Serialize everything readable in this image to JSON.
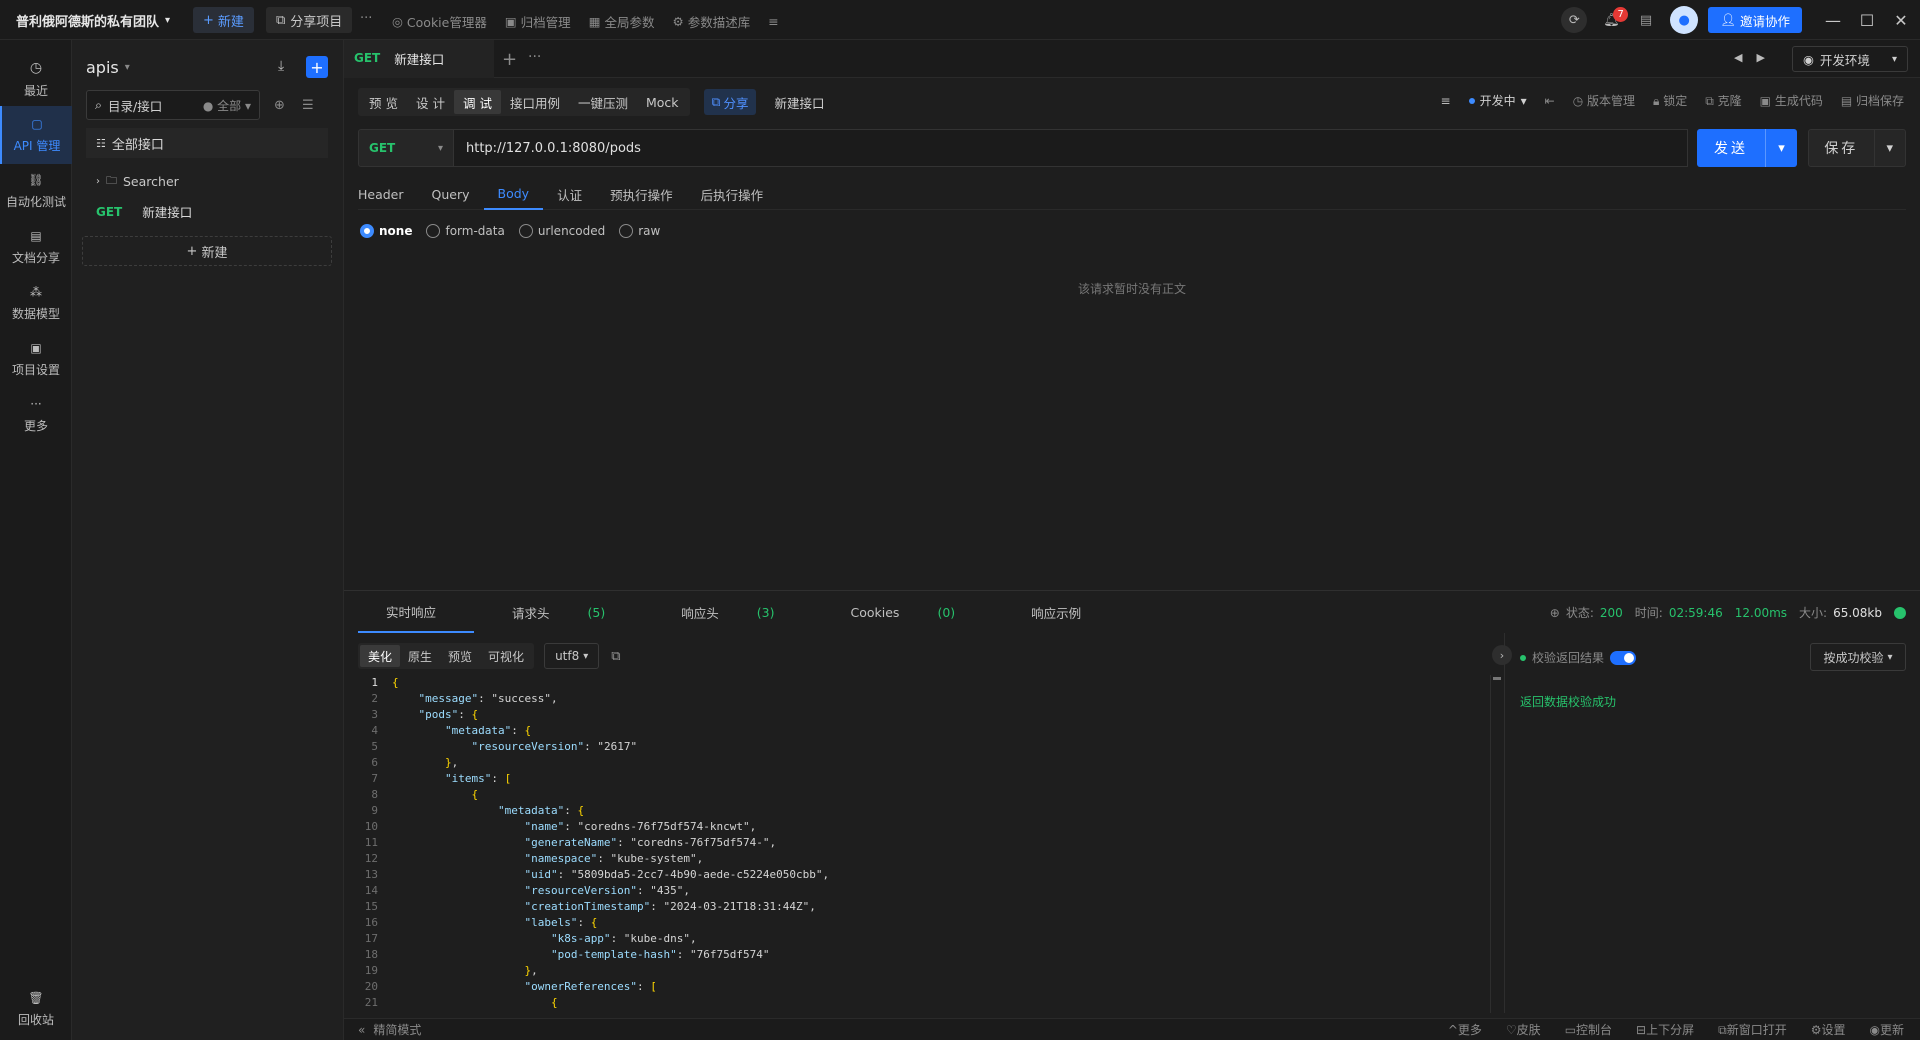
{
  "topbar": {
    "team": "普利俄阿德斯的私有团队",
    "new_btn": "新建",
    "share_project": "分享项目",
    "more": "···",
    "nav": [
      "Cookie管理器",
      "归档管理",
      "全局参数",
      "参数描述库"
    ],
    "notif_count": "7",
    "invite": "邀请协作"
  },
  "leftbar": {
    "items": [
      "最近",
      "API 管理",
      "自动化测试",
      "文档分享",
      "数据模型",
      "项目设置",
      "更多"
    ],
    "trash": "回收站"
  },
  "tree": {
    "project": "apis",
    "search_value": "目录/接口",
    "filter": "全部",
    "all_label": "全部接口",
    "folder": "Searcher",
    "request_method": "GET",
    "request_name": "新建接口",
    "new_btn": "新建"
  },
  "tabs": {
    "active": {
      "method": "GET",
      "name": "新建接口"
    },
    "env": "开发环境"
  },
  "toolbar": {
    "modes": [
      "预 览",
      "设 计",
      "调 试",
      "接口用例",
      "一键压测",
      "Mock"
    ],
    "active_mode": "调 试",
    "share": "分享",
    "name": "新建接口",
    "status": "开发中",
    "actions": [
      "版本管理",
      "锁定",
      "克隆",
      "生成代码",
      "归档保存"
    ]
  },
  "request": {
    "method": "GET",
    "url": "http://127.0.0.1:8080/pods",
    "send": "发送",
    "save": "保存"
  },
  "param_tabs": [
    "Header",
    "Query",
    "Body",
    "认证",
    "预执行操作",
    "后执行操作"
  ],
  "active_param_tab": "Body",
  "body_types": [
    "none",
    "form-data",
    "urlencoded",
    "raw"
  ],
  "body_empty": "该请求暂时没有正文",
  "response": {
    "tabs": [
      {
        "label": "实时响应",
        "count": ""
      },
      {
        "label": "请求头",
        "count": "(5)"
      },
      {
        "label": "响应头",
        "count": "(3)"
      },
      {
        "label": "Cookies",
        "count": "(0)"
      },
      {
        "label": "响应示例",
        "count": ""
      }
    ],
    "status_label": "状态:",
    "status": "200",
    "time_label": "时间:",
    "time": "02:59:46",
    "duration": "12.00ms",
    "size_label": "大小:",
    "size": "65.08kb",
    "views": [
      "美化",
      "原生",
      "预览",
      "可视化"
    ],
    "encoding": "utf8",
    "validate_label": "校验返回结果",
    "validate_mode": "按成功校验",
    "validate_result": "返回数据校验成功"
  },
  "code_lines": [
    "{",
    "    \"message\": \"success\",",
    "    \"pods\": {",
    "        \"metadata\": {",
    "            \"resourceVersion\": \"2617\"",
    "        },",
    "        \"items\": [",
    "            {",
    "                \"metadata\": {",
    "                    \"name\": \"coredns-76f75df574-kncwt\",",
    "                    \"generateName\": \"coredns-76f75df574-\",",
    "                    \"namespace\": \"kube-system\",",
    "                    \"uid\": \"5809bda5-2cc7-4b90-aede-c5224e050cbb\",",
    "                    \"resourceVersion\": \"435\",",
    "                    \"creationTimestamp\": \"2024-03-21T18:31:44Z\",",
    "                    \"labels\": {",
    "                        \"k8s-app\": \"kube-dns\",",
    "                        \"pod-template-hash\": \"76f75df574\"",
    "                    },",
    "                    \"ownerReferences\": [",
    "                        {"
  ],
  "statusbar": {
    "left": "精简模式",
    "right": [
      "更多",
      "皮肤",
      "控制台",
      "上下分屏",
      "新窗口打开",
      "设置",
      "更新"
    ]
  },
  "colors": {
    "accent": "#1e6fff",
    "get": "#27c26c",
    "bg": "#1e1e1e"
  }
}
